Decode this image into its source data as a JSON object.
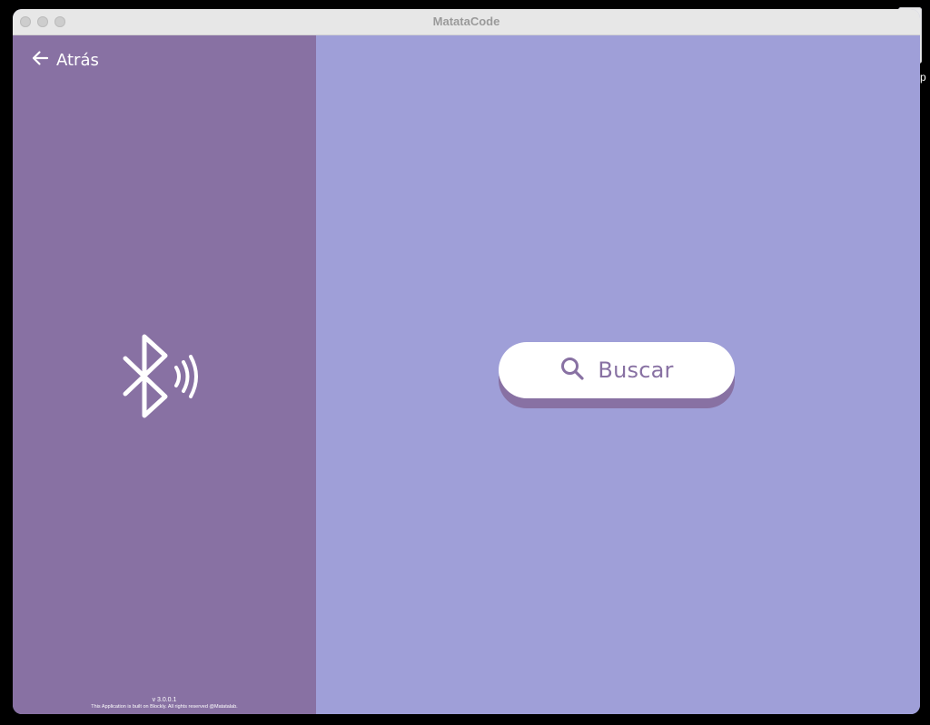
{
  "window": {
    "title": "MatataCode"
  },
  "desktop": {
    "caption_fragment": "l.p"
  },
  "left_panel": {
    "back_label": "Atrás",
    "back_icon": "arrow-left-icon",
    "status_icon": "bluetooth-icon",
    "version": "v 3.0.0.1",
    "copyright": "This Application is built on Blockly.  All rights reserved @Matatalab."
  },
  "right_panel": {
    "search_label": "Buscar",
    "search_icon": "search-icon"
  },
  "colors": {
    "left_panel_bg": "#8871a3",
    "right_panel_bg": "#9f9fd8",
    "button_bg": "#ffffff",
    "button_text": "#8871a3",
    "titlebar_bg": "#e7e7e7"
  }
}
